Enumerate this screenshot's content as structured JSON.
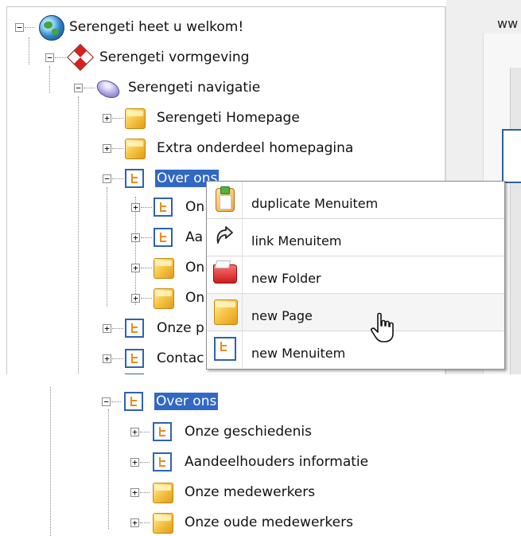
{
  "tree": {
    "root": "Serengeti heet u welkom!",
    "design": "Serengeti vormgeving",
    "navigation": "Serengeti navigatie",
    "homepage": "Serengeti Homepage",
    "extra": "Extra onderdeel homepagina",
    "about": "Over ons",
    "partial_child_1": "On",
    "partial_child_2": "Aa",
    "partial_child_3": "On",
    "partial_child_4": "On",
    "partial_sibling_1": "Onze p",
    "partial_sibling_2": "Contac"
  },
  "right_pane": {
    "url_fragment": "ww"
  },
  "context_menu": {
    "items": [
      {
        "label": "duplicate Menuitem",
        "icon": "clipboard-icon"
      },
      {
        "label": "link Menuitem",
        "icon": "link-arrow-icon"
      },
      {
        "label": "new Folder",
        "icon": "folder-icon"
      },
      {
        "label": "new Page",
        "icon": "page-icon",
        "hovered": true
      },
      {
        "label": "new Menuitem",
        "icon": "menuitem-icon"
      }
    ]
  },
  "bottom_tree": {
    "about": "Over ons",
    "children": [
      {
        "label": "Onze geschiedenis",
        "icon": "menuitem-icon"
      },
      {
        "label": "Aandeelhouders informatie",
        "icon": "menuitem-icon"
      },
      {
        "label": "Onze medewerkers",
        "icon": "page-icon"
      },
      {
        "label": "Onze oude medewerkers",
        "icon": "page-icon"
      }
    ]
  },
  "colors": {
    "selection": "#3168c5",
    "menu_border": "#2e62b4",
    "page_icon": "#f7c84a"
  }
}
